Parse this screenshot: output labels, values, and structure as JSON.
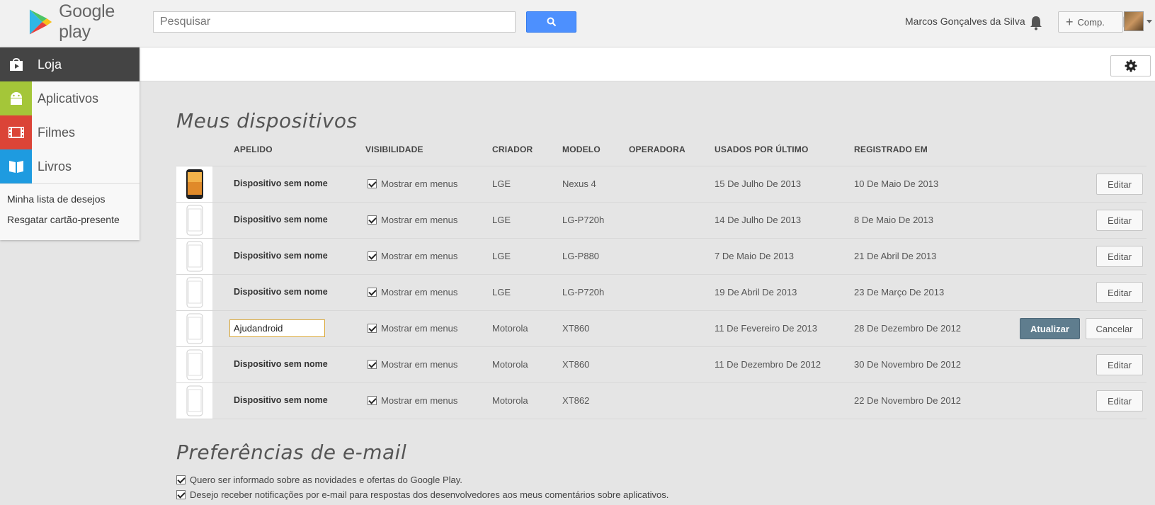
{
  "header": {
    "logo_text": "Google play",
    "search_placeholder": "Pesquisar",
    "user_name": "Marcos Gonçalves da Silva",
    "comp_label": "Comp."
  },
  "sidebar": {
    "items": [
      {
        "label": "Loja"
      },
      {
        "label": "Aplicativos"
      },
      {
        "label": "Filmes"
      },
      {
        "label": "Livros"
      }
    ],
    "links": [
      "Minha lista de desejos",
      "Resgatar cartão-presente"
    ]
  },
  "devices": {
    "title": "Meus dispositivos",
    "columns": {
      "nickname": "APELIDO",
      "visibility": "VISIBILIDADE",
      "maker": "CRIADOR",
      "model": "MODELO",
      "carrier": "OPERADORA",
      "last_used": "USADOS POR ÚLTIMO",
      "registered": "REGISTRADO EM"
    },
    "visibility_label": "Mostrar em menus",
    "edit_label": "Editar",
    "update_label": "Atualizar",
    "cancel_label": "Cancelar",
    "rows": [
      {
        "nickname": "Dispositivo sem nome",
        "maker": "LGE",
        "model": "Nexus 4",
        "last_used": "15 De Julho De 2013",
        "registered": "10 De Maio De 2013"
      },
      {
        "nickname": "Dispositivo sem nome",
        "maker": "LGE",
        "model": "LG-P720h",
        "last_used": "14 De Julho De 2013",
        "registered": "8 De Maio De 2013"
      },
      {
        "nickname": "Dispositivo sem nome",
        "maker": "LGE",
        "model": "LG-P880",
        "last_used": "7 De Maio De 2013",
        "registered": "21 De Abril De 2013"
      },
      {
        "nickname": "Dispositivo sem nome",
        "maker": "LGE",
        "model": "LG-P720h",
        "last_used": "19 De Abril De 2013",
        "registered": "23 De Março De 2013"
      },
      {
        "nickname": "Ajudandroid",
        "maker": "Motorola",
        "model": "XT860",
        "last_used": "11 De Fevereiro De 2013",
        "registered": "28 De Dezembro De 2012"
      },
      {
        "nickname": "Dispositivo sem nome",
        "maker": "Motorola",
        "model": "XT860",
        "last_used": "11 De Dezembro De 2012",
        "registered": "30 De Novembro De 2012"
      },
      {
        "nickname": "Dispositivo sem nome",
        "maker": "Motorola",
        "model": "XT862",
        "last_used": "",
        "registered": "22 De Novembro De 2012"
      }
    ]
  },
  "email_prefs": {
    "title": "Preferências de e-mail",
    "options": [
      "Quero ser informado sobre as novidades e ofertas do Google Play.",
      "Desejo receber notificações por e-mail para respostas dos desenvolvedores aos meus comentários sobre aplicativos."
    ]
  }
}
